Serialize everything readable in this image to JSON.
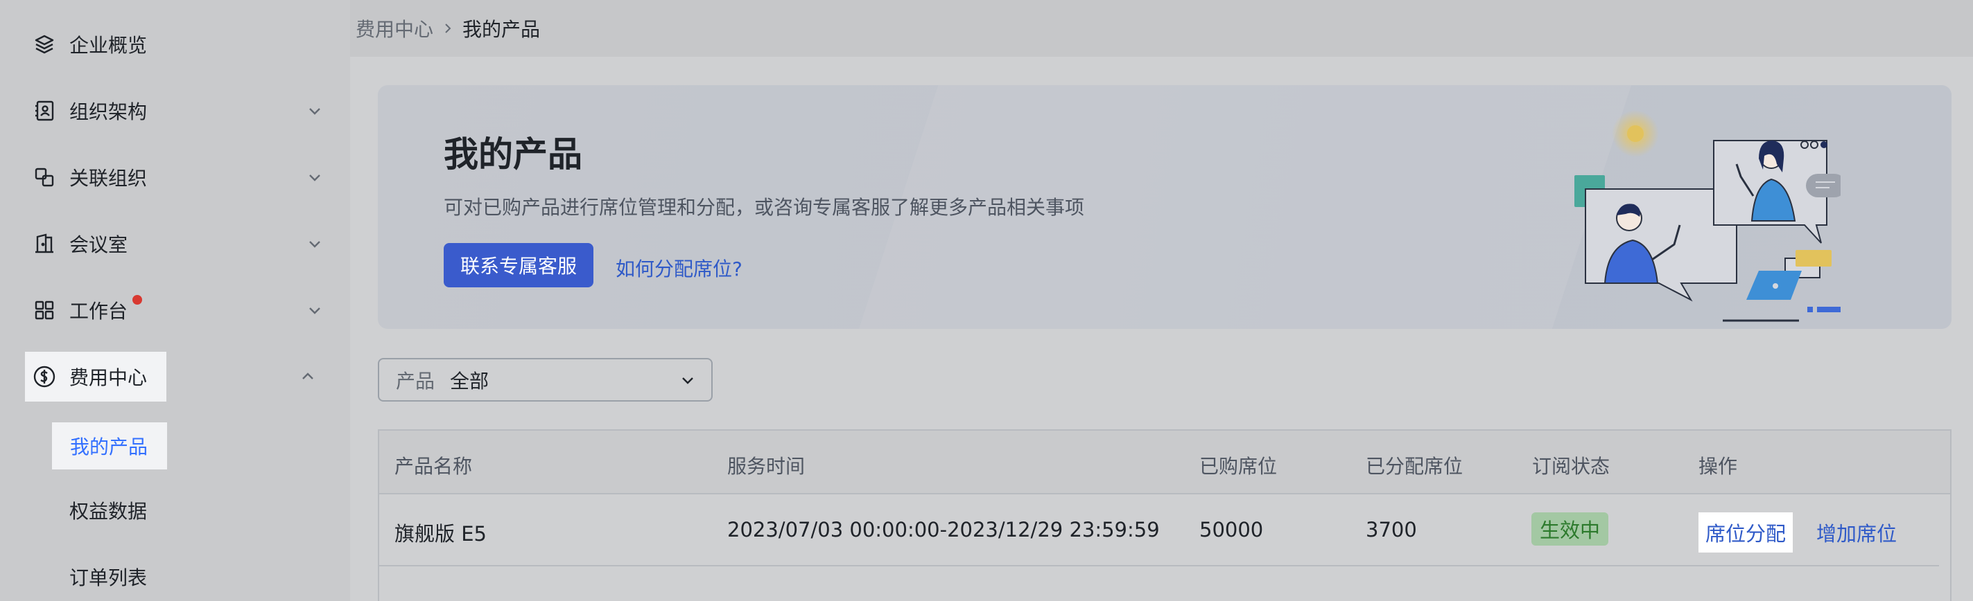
{
  "sidebar": {
    "items": [
      {
        "label": "企业概览",
        "icon": "layers-icon"
      },
      {
        "label": "组织架构",
        "icon": "contacts-icon"
      },
      {
        "label": "关联组织",
        "icon": "link-org-icon"
      },
      {
        "label": "会议室",
        "icon": "door-icon"
      },
      {
        "label": "工作台",
        "icon": "grid-apps-icon"
      },
      {
        "label": "费用中心",
        "icon": "dollar-icon"
      }
    ],
    "sub_items": [
      {
        "label": "我的产品"
      },
      {
        "label": "权益数据"
      },
      {
        "label": "订单列表"
      }
    ]
  },
  "breadcrumb": {
    "parent": "费用中心",
    "current": "我的产品"
  },
  "hero": {
    "title": "我的产品",
    "description": "可对已购产品进行席位管理和分配，或咨询专属客服了解更多产品相关事项",
    "primary_button": "联系专属客服",
    "link": "如何分配席位?"
  },
  "filter": {
    "label": "产品",
    "value": "全部"
  },
  "table": {
    "headers": [
      "产品名称",
      "服务时间",
      "已购席位",
      "已分配席位",
      "订阅状态",
      "操作"
    ],
    "rows": [
      {
        "name": "旗舰版 E5",
        "service_time": "2023/07/03 00:00:00-2023/12/29 23:59:59",
        "purchased": "50000",
        "assigned": "3700",
        "status": "生效中",
        "actions": [
          "席位分配",
          "增加席位"
        ]
      }
    ]
  },
  "colors": {
    "accent": "#3370ff",
    "primary_button": "#3a5bcc",
    "status_green": "#2c7a2c",
    "notification_dot": "#d83931"
  }
}
